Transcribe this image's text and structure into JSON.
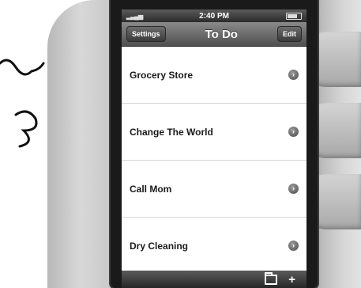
{
  "status_bar": {
    "time": "2:40 PM"
  },
  "nav_bar": {
    "left_button": "Settings",
    "title": "To Do",
    "right_button": "Edit"
  },
  "list": {
    "items": [
      {
        "label": "Grocery Store",
        "icon": "disclosure-icon"
      },
      {
        "label": "Change The World",
        "icon": "disclosure-icon"
      },
      {
        "label": "Call Mom",
        "icon": "disclosure-icon"
      },
      {
        "label": "Dry Cleaning",
        "icon": "disclosure-icon"
      }
    ]
  },
  "toolbar": {
    "buttons": [
      {
        "icon": "folder-icon"
      },
      {
        "icon": "plus-icon",
        "glyph": "+"
      }
    ]
  },
  "colors": {
    "nav_gradient_top": "#8a8a8a",
    "nav_gradient_bottom": "#4f4f4f",
    "row_text": "#1a1a1a"
  }
}
